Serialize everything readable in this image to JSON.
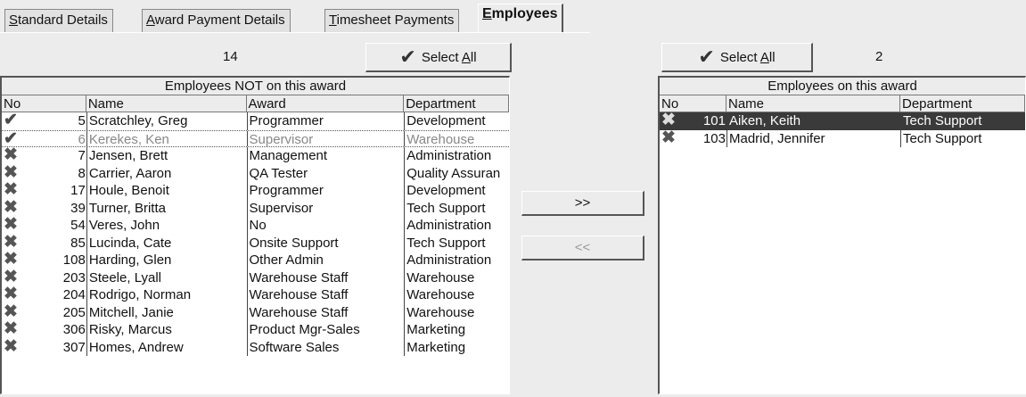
{
  "tabs": [
    {
      "label_u": "S",
      "label_rest": "tandard Details"
    },
    {
      "label_u": "A",
      "label_rest": "ward Payment Details"
    },
    {
      "label_u": "T",
      "label_rest": "imesheet Payments"
    },
    {
      "label_u": "E",
      "label_rest": "mployees"
    }
  ],
  "left": {
    "count": "14",
    "select_all_pre": "Select ",
    "select_all_u": "A",
    "select_all_post": "ll",
    "title": "Employees NOT on this award",
    "headers": {
      "no": "No",
      "name": "Name",
      "award": "Award",
      "dept": "Department"
    },
    "rows": [
      {
        "mark": "✔",
        "no": "5",
        "name": "Scratchley, Greg",
        "award": "Programmer",
        "dept": "Development"
      },
      {
        "mark": "✔",
        "no": "6",
        "name": "Kerekes, Ken",
        "award": "Supervisor",
        "dept": "Warehouse"
      },
      {
        "mark": "✖",
        "no": "7",
        "name": "Jensen, Brett",
        "award": "Management",
        "dept": "Administration"
      },
      {
        "mark": "✖",
        "no": "8",
        "name": "Carrier, Aaron",
        "award": "QA Tester",
        "dept": "Quality Assuran"
      },
      {
        "mark": "✖",
        "no": "17",
        "name": "Houle, Benoit",
        "award": "Programmer",
        "dept": "Development"
      },
      {
        "mark": "✖",
        "no": "39",
        "name": "Turner, Britta",
        "award": "Supervisor",
        "dept": "Tech Support"
      },
      {
        "mark": "✖",
        "no": "54",
        "name": "Veres, John",
        "award": "No",
        "dept": "Administration"
      },
      {
        "mark": "✖",
        "no": "85",
        "name": "Lucinda, Cate",
        "award": "Onsite Support",
        "dept": "Tech Support"
      },
      {
        "mark": "✖",
        "no": "108",
        "name": "Harding, Glen",
        "award": "Other Admin",
        "dept": "Administration"
      },
      {
        "mark": "✖",
        "no": "203",
        "name": "Steele, Lyall",
        "award": "Warehouse Staff",
        "dept": "Warehouse"
      },
      {
        "mark": "✖",
        "no": "204",
        "name": "Rodrigo, Norman",
        "award": "Warehouse Staff",
        "dept": "Warehouse"
      },
      {
        "mark": "✖",
        "no": "205",
        "name": "Mitchell, Janie",
        "award": "Warehouse Staff",
        "dept": "Warehouse"
      },
      {
        "mark": "✖",
        "no": "306",
        "name": "Risky, Marcus",
        "award": "Product Mgr-Sales",
        "dept": "Marketing"
      },
      {
        "mark": "✖",
        "no": "307",
        "name": "Homes, Andrew",
        "award": "Software Sales",
        "dept": "Marketing"
      }
    ]
  },
  "middle": {
    "add_label": ">>",
    "remove_label": "<<"
  },
  "right": {
    "count": "2",
    "select_all_pre": "Select ",
    "select_all_u": "A",
    "select_all_post": "ll",
    "title": "Employees on this award",
    "headers": {
      "no": "No",
      "name": "Name",
      "dept": "Department"
    },
    "rows": [
      {
        "mark": "✖",
        "no": "101",
        "name": "Aiken, Keith",
        "dept": "Tech Support"
      },
      {
        "mark": "✖",
        "no": "103",
        "name": "Madrid, Jennifer",
        "dept": "Tech Support"
      }
    ]
  }
}
